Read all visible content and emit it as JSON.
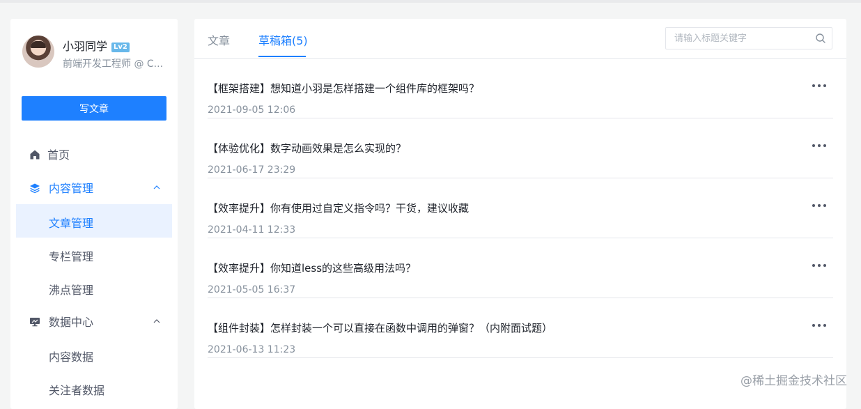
{
  "user": {
    "name": "小羽同学",
    "level": "Lv2",
    "title": "前端开发工程师 @ C..."
  },
  "write_button": "写文章",
  "nav": {
    "home": "首页",
    "content_management": "内容管理",
    "article_management": "文章管理",
    "column_management": "专栏管理",
    "pins_management": "沸点管理",
    "data_center": "数据中心",
    "content_data": "内容数据",
    "follower_data": "关注者数据"
  },
  "tabs": {
    "articles": "文章",
    "drafts": "草稿箱(5)"
  },
  "search": {
    "placeholder": "请输入标题关键字"
  },
  "drafts": [
    {
      "title": "【框架搭建】想知道小羽是怎样搭建一个组件库的框架吗？",
      "time": "2021-09-05 12:06"
    },
    {
      "title": "【体验优化】数字动画效果是怎么实现的？",
      "time": "2021-06-17 23:29"
    },
    {
      "title": "【效率提升】你有使用过自定义指令吗？干货，建议收藏",
      "time": "2021-04-11 12:33"
    },
    {
      "title": "【效率提升】你知道less的这些高级用法吗？",
      "time": "2021-05-05 16:37"
    },
    {
      "title": "【组件封装】怎样封装一个可以直接在函数中调用的弹窗？（内附面试题）",
      "time": "2021-06-13 11:23"
    }
  ],
  "watermark": "@稀土掘金技术社区",
  "colors": {
    "accent": "#1e80ff",
    "active_bg": "#eaf2ff",
    "text": "#1d2129",
    "muted": "#86909c"
  }
}
